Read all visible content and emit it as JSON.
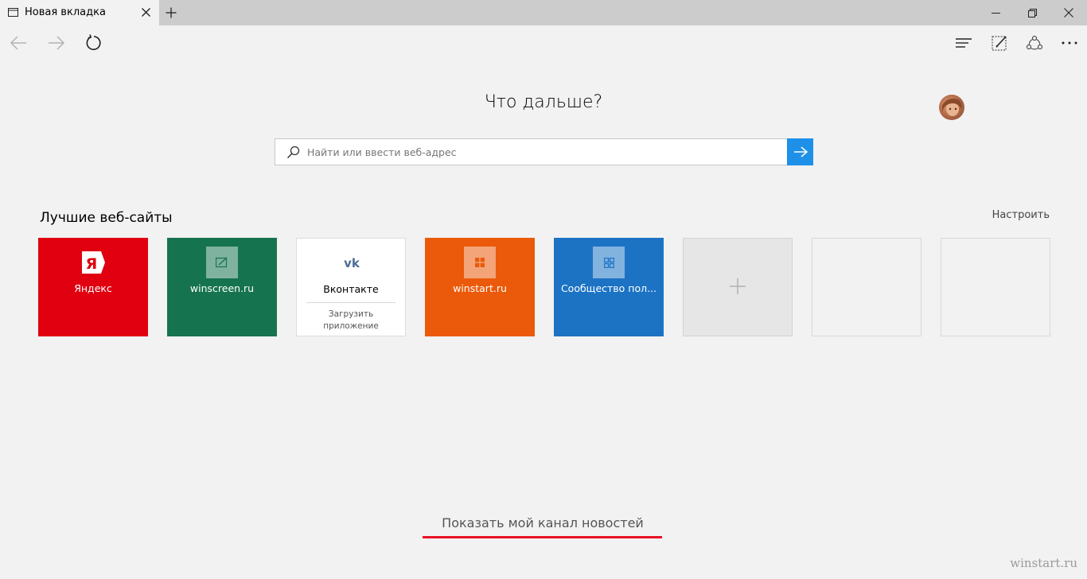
{
  "tab": {
    "title": "Новая вкладка",
    "icon": "page-icon"
  },
  "toolbar": {
    "back_icon": "arrow-left-icon",
    "forward_icon": "arrow-right-icon",
    "refresh_icon": "refresh-icon",
    "hub_icon": "hub-icon",
    "note_icon": "web-note-icon",
    "share_icon": "share-icon",
    "more_icon": "more-icon"
  },
  "main": {
    "heading": "Что дальше?",
    "search_placeholder": "Найти или ввести веб-адрес"
  },
  "top_sites": {
    "title": "Лучшие веб-сайты",
    "customize": "Настроить",
    "tiles": [
      {
        "label": "Яндекс",
        "color": "#e00010"
      },
      {
        "label": "winscreen.ru",
        "color": "#167350"
      },
      {
        "label": "Вконтакте",
        "sub": "Загрузить приложение",
        "color": "#ffffff"
      },
      {
        "label": "winstart.ru",
        "color": "#ea5a0a"
      },
      {
        "label": "Сообщество пол...",
        "color": "#1c73c4"
      }
    ]
  },
  "bottom": {
    "news_link": "Показать мой канал новостей",
    "watermark": "winstart.ru"
  },
  "colors": {
    "accent": "#1e90e8",
    "news_underline": "#e81123"
  }
}
